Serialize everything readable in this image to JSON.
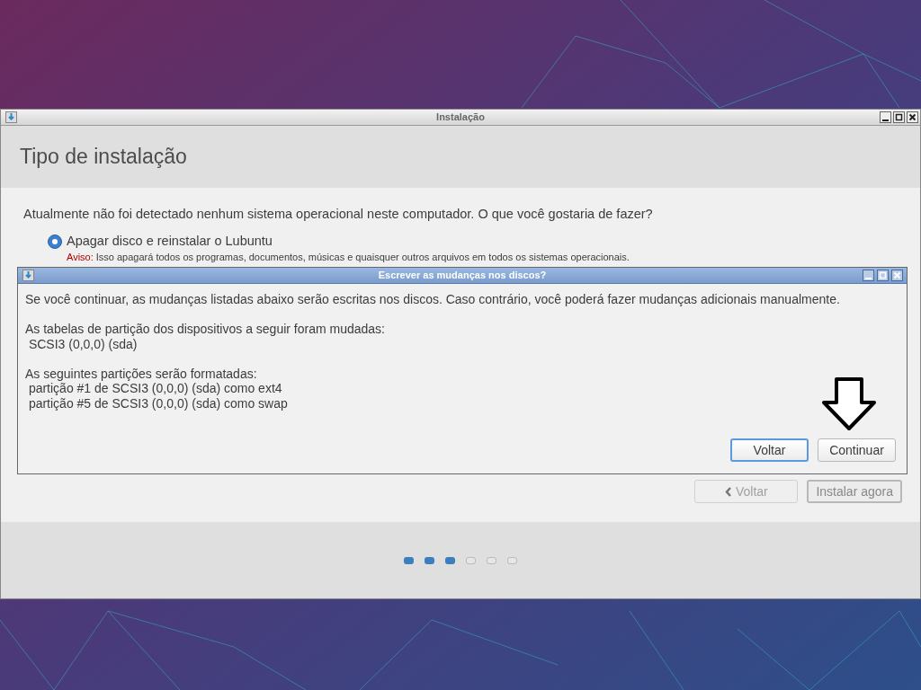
{
  "window": {
    "title": "Instalação"
  },
  "header": {
    "title": "Tipo de instalação"
  },
  "question": "Atualmente não foi detectado nenhum sistema operacional neste computador. O que você gostaria de fazer?",
  "options": [
    {
      "label": "Apagar disco e reinstalar o Lubuntu",
      "selected": true,
      "warning_label": "Aviso:",
      "warning": "Isso apagará todos os programas, documentos, músicas e quaisquer outros arquivos em todos os sistemas operacionais."
    }
  ],
  "buttons": [
    {
      "label": "Voltar",
      "disabled": true,
      "kind": "back"
    },
    {
      "label": "Instalar agora",
      "disabled": false,
      "kind": "plain"
    }
  ],
  "progress_steps": [
    {
      "done": true
    },
    {
      "done": true
    },
    {
      "done": true
    },
    {
      "done": false
    },
    {
      "done": false
    },
    {
      "done": false
    }
  ],
  "dialog": {
    "title": "Escrever as mudanças nos discos?",
    "paragraphs": [
      [
        "Se você continuar, as mudanças listadas abaixo serão escritas nos discos. Caso contrário, você poderá fazer mudanças adicionais manualmente."
      ],
      [
        "As tabelas de partição dos dispositivos a seguir foram mudadas:",
        " SCSI3 (0,0,0) (sda)"
      ],
      [
        "As seguintes partições serão formatadas:",
        " partição #1 de SCSI3 (0,0,0) (sda) como ext4",
        " partição #5 de SCSI3 (0,0,0) (sda) como swap"
      ]
    ],
    "buttons": [
      {
        "label": "Voltar",
        "default": true
      },
      {
        "label": "Continuar",
        "default": false
      }
    ]
  }
}
